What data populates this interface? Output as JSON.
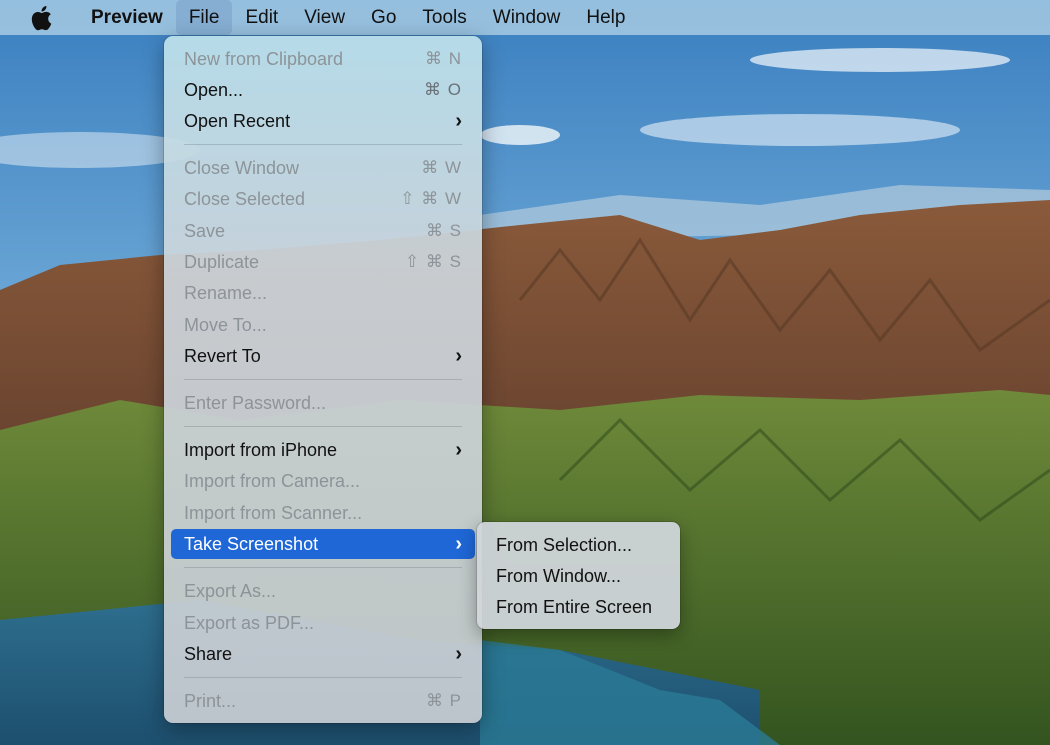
{
  "menubar": {
    "app_name": "Preview",
    "items": [
      "File",
      "Edit",
      "View",
      "Go",
      "Tools",
      "Window",
      "Help"
    ]
  },
  "file_menu": {
    "items": [
      {
        "label": "New from Clipboard",
        "shortcut": "⌘ N",
        "enabled": false
      },
      {
        "label": "Open...",
        "shortcut": "⌘ O",
        "enabled": true
      },
      {
        "label": "Open Recent",
        "submenu": true,
        "enabled": true
      },
      {
        "label": "Close Window",
        "shortcut": "⌘ W",
        "enabled": false
      },
      {
        "label": "Close Selected",
        "shortcut": "⇧ ⌘ W",
        "enabled": false
      },
      {
        "label": "Save",
        "shortcut": "⌘ S",
        "enabled": false
      },
      {
        "label": "Duplicate",
        "shortcut": "⇧ ⌘ S",
        "enabled": false
      },
      {
        "label": "Rename...",
        "enabled": false
      },
      {
        "label": "Move To...",
        "enabled": false
      },
      {
        "label": "Revert To",
        "submenu": true,
        "enabled": true
      },
      {
        "label": "Enter Password...",
        "enabled": false
      },
      {
        "label": "Import from iPhone",
        "submenu": true,
        "enabled": true
      },
      {
        "label": "Import from Camera...",
        "enabled": false
      },
      {
        "label": "Import from Scanner...",
        "enabled": false
      },
      {
        "label": "Take Screenshot",
        "submenu": true,
        "enabled": true,
        "highlighted": true
      },
      {
        "label": "Export As...",
        "enabled": false
      },
      {
        "label": "Export as PDF...",
        "enabled": false
      },
      {
        "label": "Share",
        "submenu": true,
        "enabled": true
      },
      {
        "label": "Print...",
        "shortcut": "⌘ P",
        "enabled": false
      }
    ]
  },
  "screenshot_submenu": {
    "items": [
      "From Selection...",
      "From Window...",
      "From Entire Screen"
    ]
  },
  "icons": {
    "apple": "apple-logo-icon",
    "submenu": "chevron-right-icon"
  },
  "colors": {
    "highlight": "#1f67d6",
    "disabled_text": "#8d9499"
  }
}
